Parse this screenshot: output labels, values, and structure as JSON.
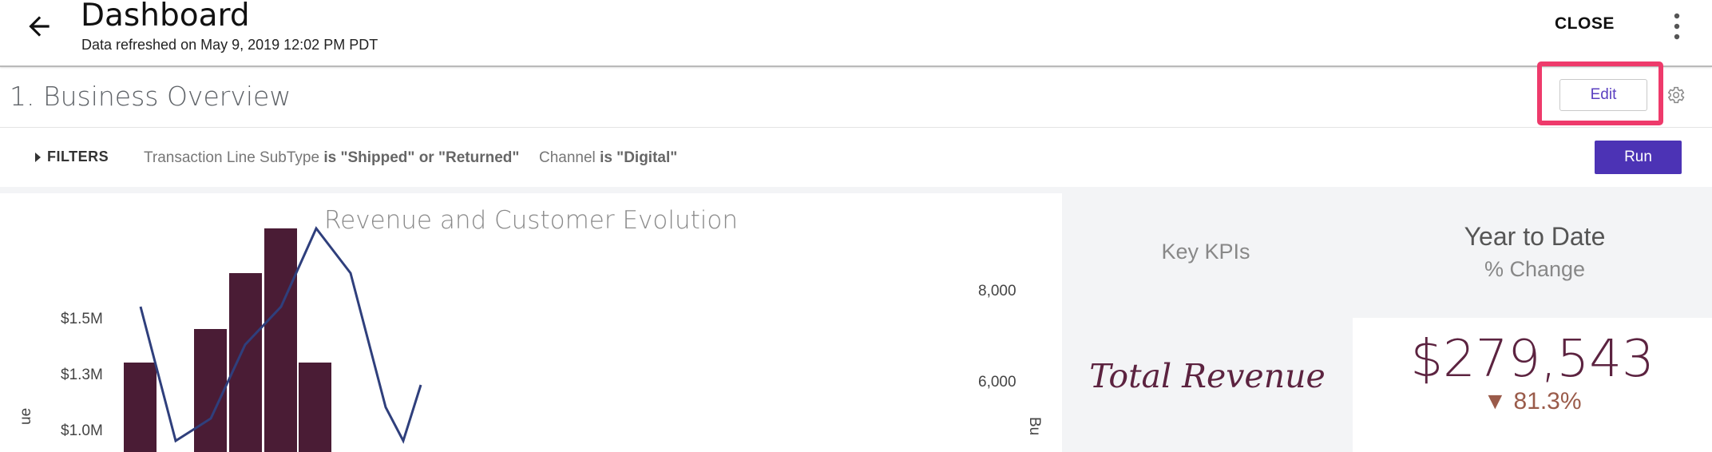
{
  "header": {
    "title": "Dashboard",
    "refreshed": "Data refreshed on May 9, 2019 12:02 PM PDT",
    "close_label": "CLOSE"
  },
  "section": {
    "title": "1. Business Overview",
    "edit_label": "Edit"
  },
  "filters": {
    "toggle_label": "FILTERS",
    "items": [
      {
        "field": "Transaction Line SubType",
        "condition": "is \"Shipped\" or \"Returned\""
      },
      {
        "field": "Channel",
        "condition": "is \"Digital\""
      }
    ],
    "run_label": "Run"
  },
  "colors": {
    "accent": "#4c33b5",
    "highlight": "#ee3a6b",
    "bar": "#4a1c35",
    "line": "#2f3f7c",
    "kpi_text": "#5c2340"
  },
  "chart": {
    "title": "Revenue and Customer Evolution",
    "left_axis_label": "ue",
    "right_axis_label": "Bu"
  },
  "chart_data": {
    "type": "bar",
    "title": "Revenue and Customer Evolution",
    "left_ticks": [
      "$1.5M",
      "$1.3M",
      "$1.0M"
    ],
    "right_ticks": [
      "8,000",
      "6,000"
    ],
    "left_tick_values": [
      1500000,
      1250000,
      1000000
    ],
    "right_tick_values": [
      8000,
      6000
    ],
    "ylim_left": [
      800000,
      1800000
    ],
    "ylim_right": [
      4500,
      8600
    ],
    "series": [
      {
        "kind": "bar",
        "values": [
          1300000,
          null,
          1450000,
          1700000,
          1900000,
          1300000
        ]
      },
      {
        "kind": "line",
        "values": [
          1550000,
          950000,
          1050000,
          1380000,
          1550000,
          1900000,
          1700000,
          1100000,
          950000,
          1200000
        ]
      }
    ]
  },
  "kpi": {
    "key_heading": "Key KPIs",
    "ytd_heading": "Year to Date",
    "ytd_sub": "% Change",
    "label": "Total Revenue",
    "value": "$279,543",
    "change": "▼ 81.3%"
  }
}
